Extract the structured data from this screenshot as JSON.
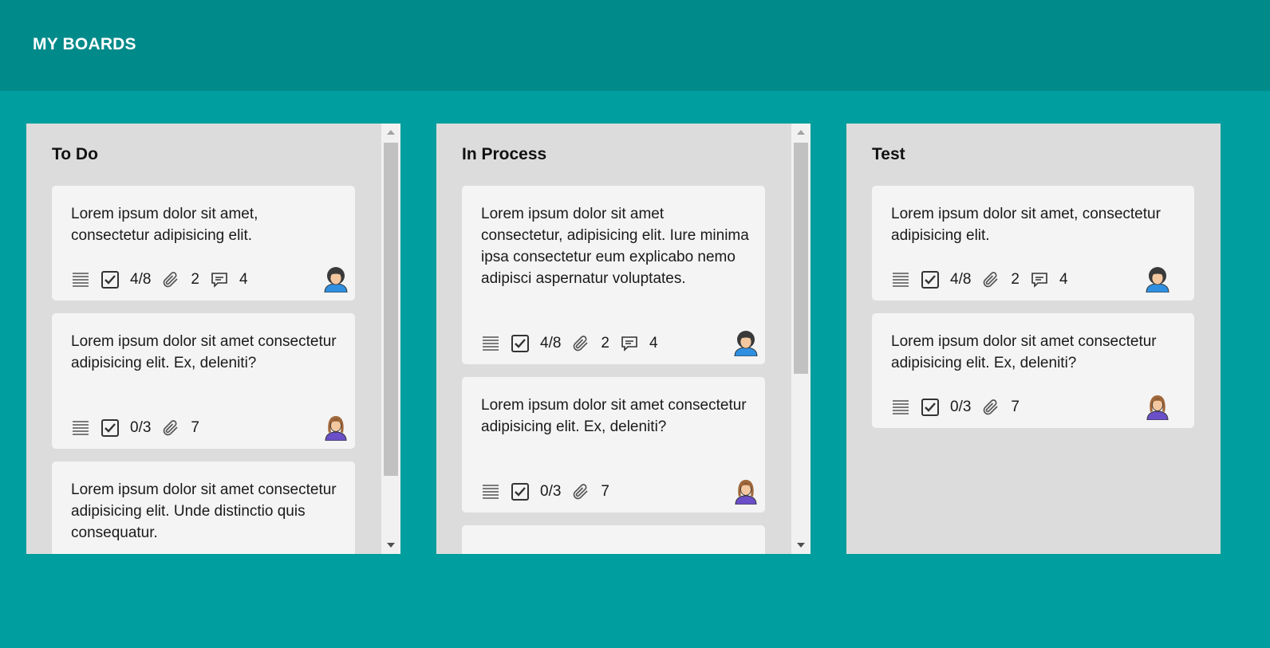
{
  "header": {
    "title": "MY BOARDS"
  },
  "columns": [
    {
      "title": "To Do",
      "cards": [
        {
          "text": "Lorem ipsum dolor sit amet, consectetur adipisicing elit.",
          "checklist": "4/8",
          "attachments": "2",
          "comments": "4",
          "avatar": "male-user-avatar"
        },
        {
          "text": "Lorem ipsum dolor sit amet consectetur adipisicing elit. Ex, deleniti?",
          "checklist": "0/3",
          "attachments": "7",
          "avatar": "female-user-avatar"
        },
        {
          "text": "Lorem ipsum dolor sit amet consectetur adipisicing elit. Unde distinctio quis consequatur."
        }
      ]
    },
    {
      "title": "In Process",
      "cards": [
        {
          "text": "Lorem ipsum dolor sit amet consectetur, adipisicing elit. Iure minima ipsa consectetur eum explicabo nemo adipisci aspernatur voluptates.",
          "checklist": "4/8",
          "attachments": "2",
          "comments": "4",
          "avatar": "male-user-avatar"
        },
        {
          "text": "Lorem ipsum dolor sit amet consectetur adipisicing elit. Ex, deleniti?",
          "checklist": "0/3",
          "attachments": "7",
          "avatar": "female-user-avatar"
        }
      ]
    },
    {
      "title": "Test",
      "cards": [
        {
          "text": "Lorem ipsum dolor sit amet, consectetur adipisicing elit.",
          "checklist": "4/8",
          "attachments": "2",
          "comments": "4",
          "avatar": "male-user-avatar"
        },
        {
          "text": "Lorem ipsum dolor sit amet consectetur adipisicing elit. Ex, deleniti?",
          "checklist": "0/3",
          "attachments": "7",
          "avatar": "female-user-avatar"
        }
      ]
    }
  ],
  "icons": {
    "description": "description-lines-icon",
    "checklist": "checkbox-icon",
    "attachments": "paperclip-icon",
    "comments": "comment-bubble-icon"
  },
  "colors": {
    "header_bg": "#008a8a",
    "page_bg": "#009e9e",
    "column_bg": "#dcdcdc",
    "card_bg": "#f4f4f4",
    "male_avatar_shirt": "#2f8fe0",
    "female_avatar_shirt": "#6a4fc8"
  }
}
